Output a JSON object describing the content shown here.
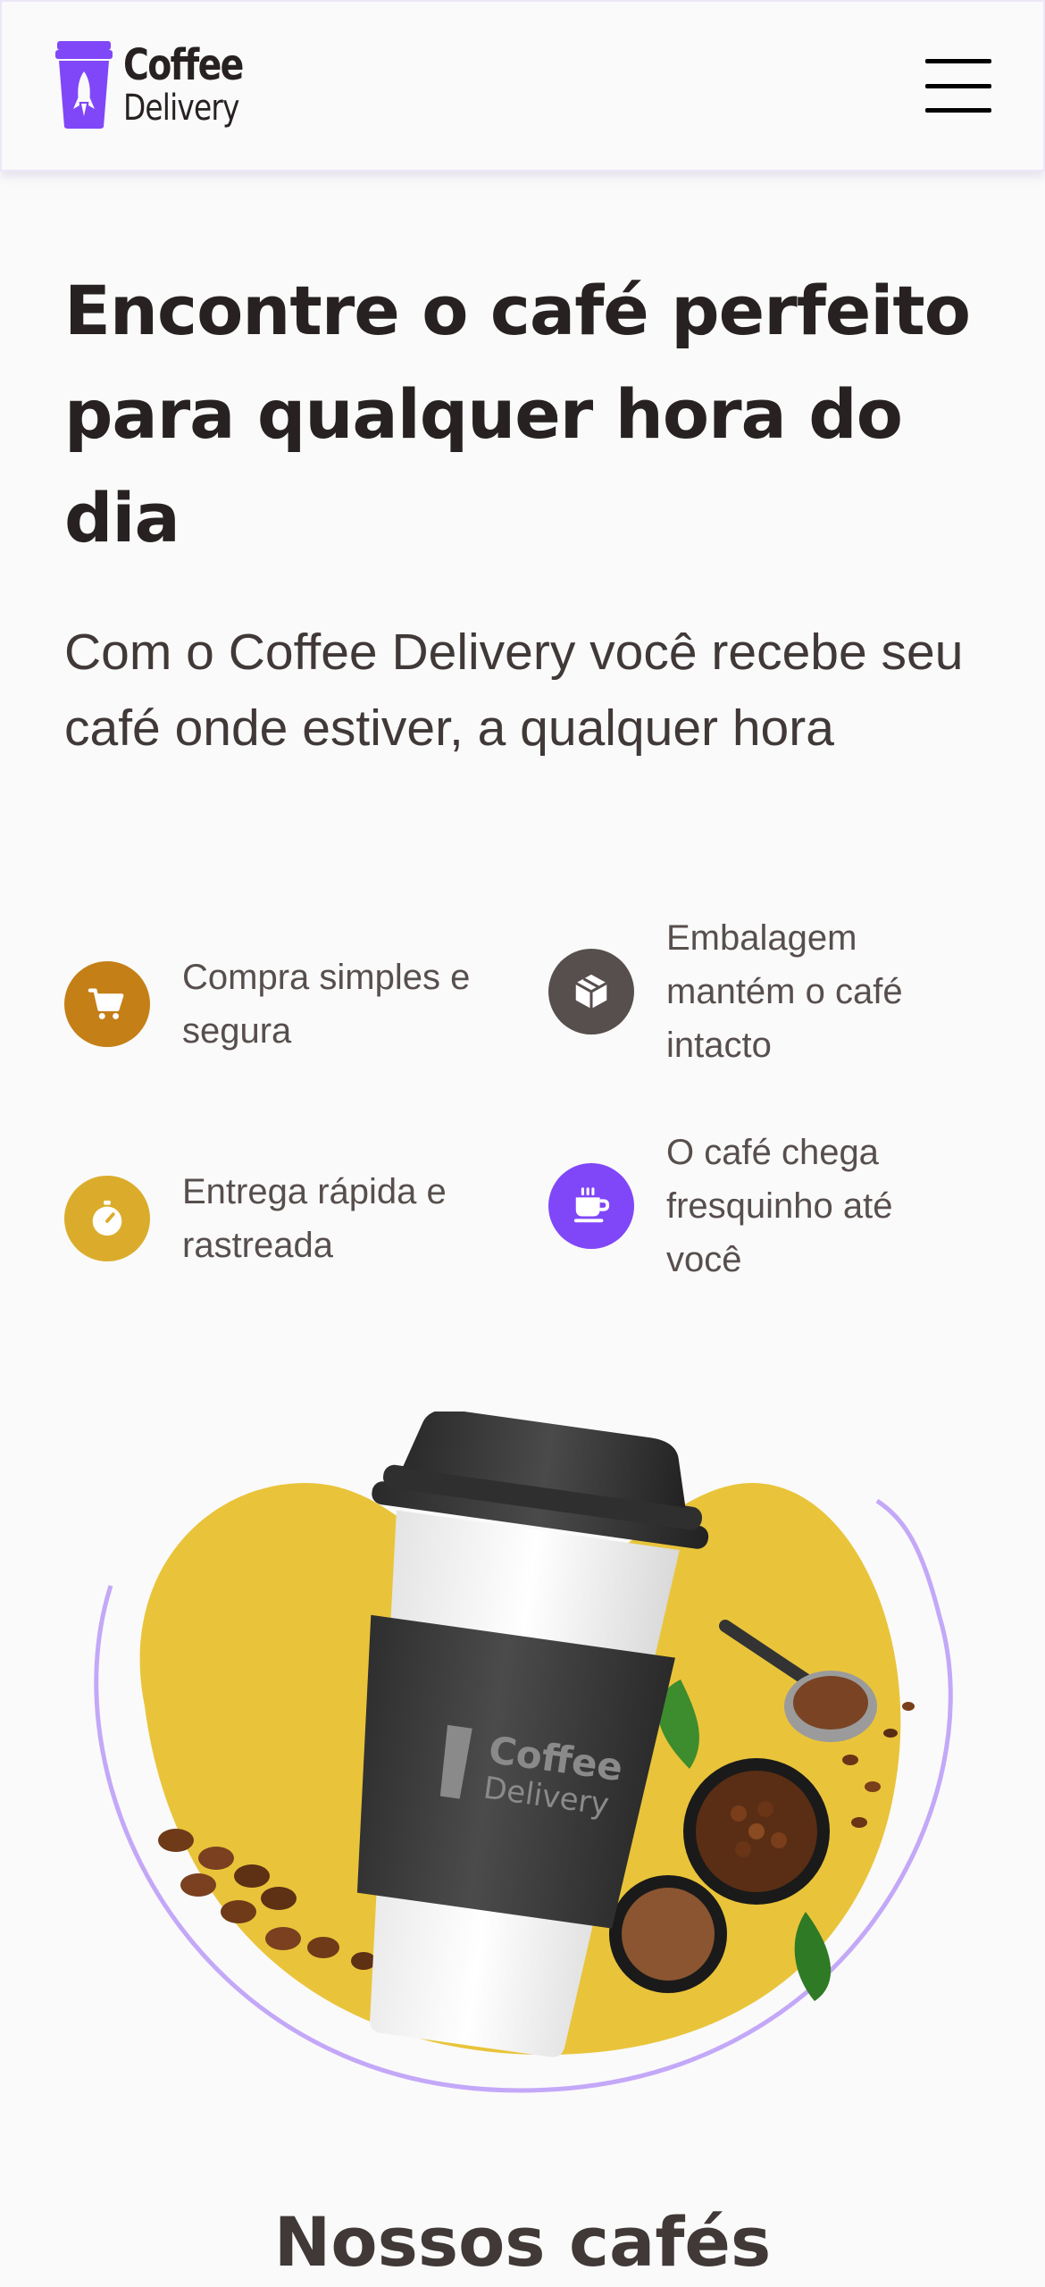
{
  "header": {
    "logo": {
      "line1": "Coffee",
      "line2": "Delivery",
      "icon": "rocket-cup-icon"
    },
    "menu_icon": "hamburger-menu-icon"
  },
  "hero": {
    "title": "Encontre o café perfeito para qualquer hora do dia",
    "subtitle": "Com o Coffee Delivery você recebe seu café onde estiver, a qualquer hora"
  },
  "features": [
    {
      "text": "Compra simples e segura",
      "icon": "shopping-cart-icon",
      "color": "#C47F17"
    },
    {
      "text": "Embalagem mantém o café intacto",
      "icon": "package-icon",
      "color": "#574F4D"
    },
    {
      "text": "Entrega rápida e rastreada",
      "icon": "timer-icon",
      "color": "#DBAC2C"
    },
    {
      "text": "O café chega fresquinho até você",
      "icon": "coffee-cup-icon",
      "color": "#8047F8"
    }
  ],
  "hero_image": {
    "cup_logo_line1": "Coffee",
    "cup_logo_line2": "Delivery"
  },
  "section": {
    "title": "Nossos cafés"
  },
  "colors": {
    "purple": "#8047F8",
    "purple_light": "#C4A8F8",
    "yellow": "#E9C43A",
    "title": "#272221",
    "text": "#574F4D",
    "background": "#FAFAFA"
  }
}
